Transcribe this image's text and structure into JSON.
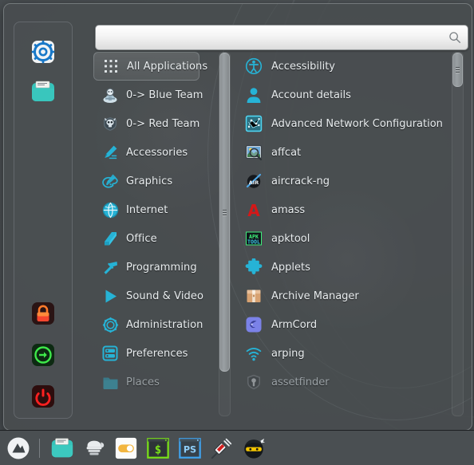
{
  "window": {
    "title": "Application Menu",
    "accent_color": "#26b3d6",
    "panel_bg": "#484c4f",
    "text_color": "#e9edef",
    "dim_text_color": "#9aa1a5"
  },
  "search": {
    "value": "",
    "placeholder": "",
    "icon": "search-icon"
  },
  "system_bar": {
    "items": [
      {
        "name": "system-settings",
        "icon": "gear-icon",
        "label": "System Settings"
      },
      {
        "name": "file-manager",
        "icon": "folder-icon",
        "label": "Files"
      },
      {
        "name": "lock-screen",
        "icon": "lock-icon",
        "label": "Lock Screen"
      },
      {
        "name": "log-out",
        "icon": "logout-icon",
        "label": "Log Out"
      },
      {
        "name": "shut-down",
        "icon": "power-icon",
        "label": "Shut Down"
      }
    ]
  },
  "categories": {
    "selected": "All Applications",
    "items": [
      {
        "label": "All Applications",
        "icon": "grid-icon",
        "selected": true,
        "dim": false
      },
      {
        "label": "0-> Blue Team",
        "icon": "blue-team-icon",
        "selected": false,
        "dim": false
      },
      {
        "label": "0-> Red Team",
        "icon": "red-team-icon",
        "selected": false,
        "dim": false
      },
      {
        "label": "Accessories",
        "icon": "pencil-icon",
        "selected": false,
        "dim": false
      },
      {
        "label": "Graphics",
        "icon": "palette-icon",
        "selected": false,
        "dim": false
      },
      {
        "label": "Internet",
        "icon": "globe-icon",
        "selected": false,
        "dim": false
      },
      {
        "label": "Office",
        "icon": "book-icon",
        "selected": false,
        "dim": false
      },
      {
        "label": "Programming",
        "icon": "hammer-icon",
        "selected": false,
        "dim": false
      },
      {
        "label": "Sound & Video",
        "icon": "play-icon",
        "selected": false,
        "dim": false
      },
      {
        "label": "Administration",
        "icon": "cog-outline-icon",
        "selected": false,
        "dim": false
      },
      {
        "label": "Preferences",
        "icon": "sliders-icon",
        "selected": false,
        "dim": false
      },
      {
        "label": "Places",
        "icon": "places-folder-icon",
        "selected": false,
        "dim": true
      }
    ]
  },
  "applications": {
    "items": [
      {
        "label": "Accessibility",
        "icon": "accessibility-icon",
        "dim": false
      },
      {
        "label": "Account details",
        "icon": "user-icon",
        "dim": false
      },
      {
        "label": "Advanced Network Configuration",
        "icon": "network-config-icon",
        "dim": false
      },
      {
        "label": "affcat",
        "icon": "affcat-icon",
        "dim": false
      },
      {
        "label": "aircrack-ng",
        "icon": "aircrack-icon",
        "dim": false
      },
      {
        "label": "amass",
        "icon": "amass-icon",
        "dim": false
      },
      {
        "label": "apktool",
        "icon": "apktool-icon",
        "dim": false
      },
      {
        "label": "Applets",
        "icon": "puzzle-icon",
        "dim": false
      },
      {
        "label": "Archive Manager",
        "icon": "archive-icon",
        "dim": false
      },
      {
        "label": "ArmCord",
        "icon": "armcord-icon",
        "dim": false
      },
      {
        "label": "arping",
        "icon": "wifi-icon",
        "dim": false
      },
      {
        "label": "assetfinder",
        "icon": "assetfinder-icon",
        "dim": true
      }
    ]
  },
  "scrollbars": {
    "category": {
      "thumb_top_pct": 0,
      "thumb_height_pct": 88
    },
    "application": {
      "thumb_top_pct": 0,
      "thumb_height_pct": 10
    }
  },
  "taskbar": {
    "items": [
      {
        "name": "menu-button",
        "icon": "distro-logo-icon"
      },
      {
        "name": "separator",
        "icon": "separator"
      },
      {
        "name": "file-manager-task",
        "icon": "folder-icon"
      },
      {
        "name": "cpu-fan-task",
        "icon": "fan-icon"
      },
      {
        "name": "toggle-task",
        "icon": "toggle-icon"
      },
      {
        "name": "terminal-task",
        "icon": "terminal-icon"
      },
      {
        "name": "powershell-task",
        "icon": "powershell-icon"
      },
      {
        "name": "syringe-task",
        "icon": "syringe-icon"
      },
      {
        "name": "hacker-task",
        "icon": "hacker-icon"
      }
    ]
  }
}
